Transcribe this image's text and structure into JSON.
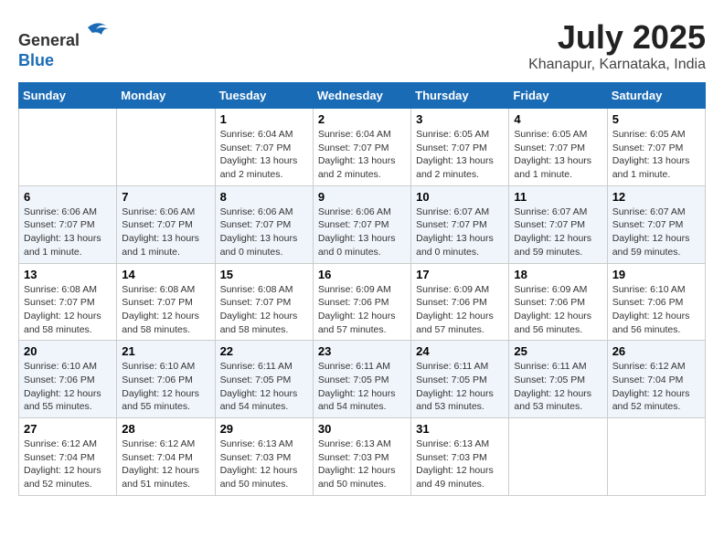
{
  "logo": {
    "line1": "General",
    "line2": "Blue"
  },
  "title": "July 2025",
  "location": "Khanapur, Karnataka, India",
  "weekdays": [
    "Sunday",
    "Monday",
    "Tuesday",
    "Wednesday",
    "Thursday",
    "Friday",
    "Saturday"
  ],
  "weeks": [
    [
      {
        "day": "",
        "detail": ""
      },
      {
        "day": "",
        "detail": ""
      },
      {
        "day": "1",
        "detail": "Sunrise: 6:04 AM\nSunset: 7:07 PM\nDaylight: 13 hours and 2 minutes."
      },
      {
        "day": "2",
        "detail": "Sunrise: 6:04 AM\nSunset: 7:07 PM\nDaylight: 13 hours and 2 minutes."
      },
      {
        "day": "3",
        "detail": "Sunrise: 6:05 AM\nSunset: 7:07 PM\nDaylight: 13 hours and 2 minutes."
      },
      {
        "day": "4",
        "detail": "Sunrise: 6:05 AM\nSunset: 7:07 PM\nDaylight: 13 hours and 1 minute."
      },
      {
        "day": "5",
        "detail": "Sunrise: 6:05 AM\nSunset: 7:07 PM\nDaylight: 13 hours and 1 minute."
      }
    ],
    [
      {
        "day": "6",
        "detail": "Sunrise: 6:06 AM\nSunset: 7:07 PM\nDaylight: 13 hours and 1 minute."
      },
      {
        "day": "7",
        "detail": "Sunrise: 6:06 AM\nSunset: 7:07 PM\nDaylight: 13 hours and 1 minute."
      },
      {
        "day": "8",
        "detail": "Sunrise: 6:06 AM\nSunset: 7:07 PM\nDaylight: 13 hours and 0 minutes."
      },
      {
        "day": "9",
        "detail": "Sunrise: 6:06 AM\nSunset: 7:07 PM\nDaylight: 13 hours and 0 minutes."
      },
      {
        "day": "10",
        "detail": "Sunrise: 6:07 AM\nSunset: 7:07 PM\nDaylight: 13 hours and 0 minutes."
      },
      {
        "day": "11",
        "detail": "Sunrise: 6:07 AM\nSunset: 7:07 PM\nDaylight: 12 hours and 59 minutes."
      },
      {
        "day": "12",
        "detail": "Sunrise: 6:07 AM\nSunset: 7:07 PM\nDaylight: 12 hours and 59 minutes."
      }
    ],
    [
      {
        "day": "13",
        "detail": "Sunrise: 6:08 AM\nSunset: 7:07 PM\nDaylight: 12 hours and 58 minutes."
      },
      {
        "day": "14",
        "detail": "Sunrise: 6:08 AM\nSunset: 7:07 PM\nDaylight: 12 hours and 58 minutes."
      },
      {
        "day": "15",
        "detail": "Sunrise: 6:08 AM\nSunset: 7:07 PM\nDaylight: 12 hours and 58 minutes."
      },
      {
        "day": "16",
        "detail": "Sunrise: 6:09 AM\nSunset: 7:06 PM\nDaylight: 12 hours and 57 minutes."
      },
      {
        "day": "17",
        "detail": "Sunrise: 6:09 AM\nSunset: 7:06 PM\nDaylight: 12 hours and 57 minutes."
      },
      {
        "day": "18",
        "detail": "Sunrise: 6:09 AM\nSunset: 7:06 PM\nDaylight: 12 hours and 56 minutes."
      },
      {
        "day": "19",
        "detail": "Sunrise: 6:10 AM\nSunset: 7:06 PM\nDaylight: 12 hours and 56 minutes."
      }
    ],
    [
      {
        "day": "20",
        "detail": "Sunrise: 6:10 AM\nSunset: 7:06 PM\nDaylight: 12 hours and 55 minutes."
      },
      {
        "day": "21",
        "detail": "Sunrise: 6:10 AM\nSunset: 7:06 PM\nDaylight: 12 hours and 55 minutes."
      },
      {
        "day": "22",
        "detail": "Sunrise: 6:11 AM\nSunset: 7:05 PM\nDaylight: 12 hours and 54 minutes."
      },
      {
        "day": "23",
        "detail": "Sunrise: 6:11 AM\nSunset: 7:05 PM\nDaylight: 12 hours and 54 minutes."
      },
      {
        "day": "24",
        "detail": "Sunrise: 6:11 AM\nSunset: 7:05 PM\nDaylight: 12 hours and 53 minutes."
      },
      {
        "day": "25",
        "detail": "Sunrise: 6:11 AM\nSunset: 7:05 PM\nDaylight: 12 hours and 53 minutes."
      },
      {
        "day": "26",
        "detail": "Sunrise: 6:12 AM\nSunset: 7:04 PM\nDaylight: 12 hours and 52 minutes."
      }
    ],
    [
      {
        "day": "27",
        "detail": "Sunrise: 6:12 AM\nSunset: 7:04 PM\nDaylight: 12 hours and 52 minutes."
      },
      {
        "day": "28",
        "detail": "Sunrise: 6:12 AM\nSunset: 7:04 PM\nDaylight: 12 hours and 51 minutes."
      },
      {
        "day": "29",
        "detail": "Sunrise: 6:13 AM\nSunset: 7:03 PM\nDaylight: 12 hours and 50 minutes."
      },
      {
        "day": "30",
        "detail": "Sunrise: 6:13 AM\nSunset: 7:03 PM\nDaylight: 12 hours and 50 minutes."
      },
      {
        "day": "31",
        "detail": "Sunrise: 6:13 AM\nSunset: 7:03 PM\nDaylight: 12 hours and 49 minutes."
      },
      {
        "day": "",
        "detail": ""
      },
      {
        "day": "",
        "detail": ""
      }
    ]
  ]
}
